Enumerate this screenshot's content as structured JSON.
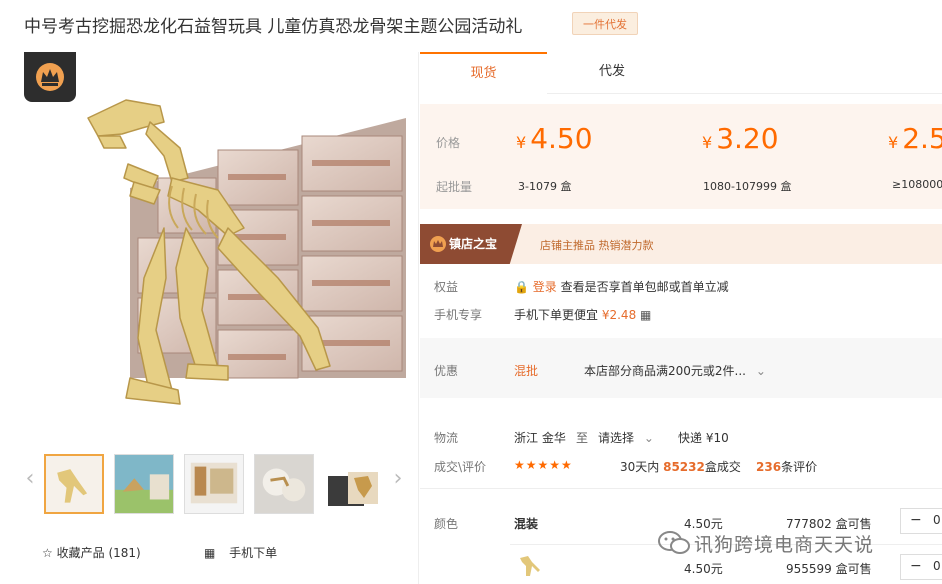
{
  "product": {
    "title": "中号考古挖掘恐龙化石益智玩具 儿童仿真恐龙骨架主题公园活动礼",
    "tag": "一件代发"
  },
  "tabs": [
    {
      "label": "现货"
    },
    {
      "label": "代发"
    }
  ],
  "price_panel": {
    "price_label": "价格",
    "qty_label": "起批量",
    "currency": "¥",
    "tiers": [
      {
        "price": "4.50",
        "range": "3-1079 盒"
      },
      {
        "price": "3.20",
        "range": "1080-107999 盒"
      },
      {
        "price": "2.5",
        "range": "≥108000"
      }
    ]
  },
  "shop_banner": {
    "title": "镇店之宝",
    "text": "店铺主推品  热销潜力款"
  },
  "rights": {
    "label": "权益",
    "login": "登录",
    "text": "查看是否享首单包邮或首单立减"
  },
  "mobile_exclusive": {
    "label": "手机专享",
    "text": "手机下单更便宜",
    "price": "¥2.48"
  },
  "promo": {
    "label": "优惠",
    "tag": "混批",
    "text": "本店部分商品满200元或2件..."
  },
  "logistics": {
    "label": "物流",
    "from": "浙江 金华",
    "to_word": "至",
    "select": "请选择",
    "express": "快递 ¥10"
  },
  "deals": {
    "label": "成交\\评价",
    "stars": "★★★★★",
    "prefix": "30天内",
    "count": "85232",
    "unit": "盒成交",
    "reviews": "236",
    "reviews_unit": "条评价"
  },
  "variants": {
    "label": "颜色",
    "rows": [
      {
        "name": "混装",
        "price": "4.50元",
        "stock": "777802 盒可售",
        "qty": "0"
      },
      {
        "name": "",
        "price": "4.50元",
        "stock": "955599 盒可售",
        "qty": "0"
      }
    ]
  },
  "gallery": {
    "favorite": "收藏产品",
    "favorite_count": "(181)",
    "mobile_order": "手机下单"
  },
  "watermark": "讯狗跨境电商天天说",
  "colors": {
    "accent": "#ff6a00",
    "price_bg": "#fdf4ee",
    "banner_dark": "#8e4b33"
  }
}
